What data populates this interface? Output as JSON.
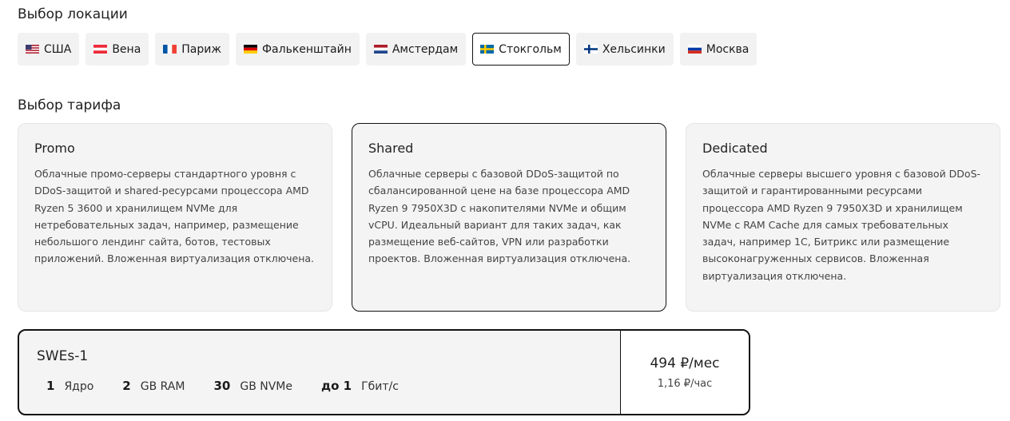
{
  "location_section": {
    "title": "Выбор локации",
    "items": [
      {
        "label": "США",
        "flag": "us-flag-icon"
      },
      {
        "label": "Вена",
        "flag": "austria-flag-icon"
      },
      {
        "label": "Париж",
        "flag": "france-flag-icon"
      },
      {
        "label": "Фалькенштайн",
        "flag": "germany-flag-icon"
      },
      {
        "label": "Амстердам",
        "flag": "netherlands-flag-icon"
      },
      {
        "label": "Стокгольм",
        "flag": "sweden-flag-icon",
        "selected": true
      },
      {
        "label": "Хельсинки",
        "flag": "finland-flag-icon"
      },
      {
        "label": "Москва",
        "flag": "russia-flag-icon"
      }
    ]
  },
  "plan_section": {
    "title": "Выбор тарифа",
    "plans": [
      {
        "name": "Promo",
        "description": "Облачные промо-серверы стандартного уровня с DDoS-защитой и shared-ресурсами процессора AMD Ryzen 5 3600 и хранилищем NVMe для нетребовательных задач, например, размещение небольшого лендинг сайта, ботов, тестовых приложений. Вложенная виртуализация отключена."
      },
      {
        "name": "Shared",
        "description": "Облачные серверы с базовой DDoS-защитой по сбалансированной цене на базе процессора AMD Ryzen 9 7950X3D с накопителями NVMe и общим vCPU. Идеальный вариант для таких задач, как размещение веб-сайтов, VPN или разработки проектов. Вложенная виртуализация отключена.",
        "selected": true
      },
      {
        "name": "Dedicated",
        "description": "Облачные серверы высшего уровня с базовой DDoS-защитой и гарантированными ресурсами процессора AMD Ryzen 9 7950X3D и хранилищем NVMe с RAM Cache для самых требовательных задач, например 1С, Битрикс или размещение высоконагруженных сервисов. Вложенная виртуализация отключена."
      }
    ]
  },
  "tariff": {
    "name": "SWEs-1",
    "specs": [
      {
        "value": "1",
        "unit": "Ядро"
      },
      {
        "value": "2",
        "unit": "GB RAM"
      },
      {
        "value": "30",
        "unit": "GB NVMe"
      },
      {
        "value": "до 1",
        "unit": "Гбит/с"
      }
    ],
    "price_month": "494 ₽/мес",
    "price_hour": "1,16 ₽/час"
  },
  "colors": {
    "accent_border": "#111111",
    "card_bg": "#f4f4f4",
    "chip_bg": "#f2f2f2"
  }
}
